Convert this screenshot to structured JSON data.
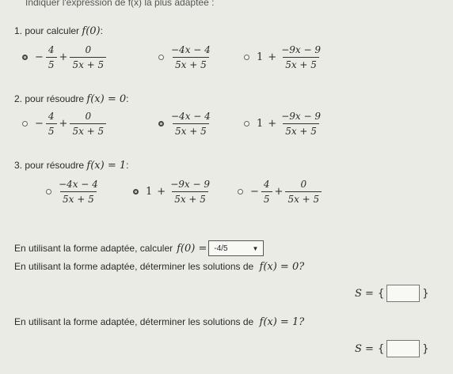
{
  "header": {
    "text": "Indiquer l'expression de f(x) la plus adaptée :"
  },
  "q1": {
    "label": "1. pour calculer",
    "fx": "f(0)",
    "suffix": ":",
    "options": [
      {
        "selected": true,
        "kind": "a"
      },
      {
        "selected": false,
        "kind": "b"
      },
      {
        "selected": false,
        "kind": "c"
      }
    ]
  },
  "q2": {
    "label": "2. pour résoudre",
    "eq": "f(x) = 0",
    "suffix": ":",
    "options": [
      {
        "selected": false,
        "kind": "a"
      },
      {
        "selected": true,
        "kind": "b"
      },
      {
        "selected": false,
        "kind": "c"
      }
    ]
  },
  "q3": {
    "label": "3. pour résoudre",
    "eq": "f(x) = 1",
    "suffix": ":",
    "options": [
      {
        "selected": false,
        "kind": "b"
      },
      {
        "selected": true,
        "kind": "c"
      },
      {
        "selected": false,
        "kind": "a"
      }
    ]
  },
  "expr": {
    "a": {
      "neg": "−",
      "f1_num": "4",
      "f1_den": "5",
      "plus": "+",
      "f2_num": "0",
      "f2_den": "5x + 5"
    },
    "b": {
      "num": "−4x − 4",
      "den": "5x + 5"
    },
    "c": {
      "one": "1",
      "plus": "+",
      "num": "−9x − 9",
      "den": "5x + 5"
    }
  },
  "compute": {
    "text": "En utilisant la forme adaptée, calculer",
    "fx": "f(0) =",
    "dropdown_value": "-4/5",
    "caret": "▼"
  },
  "solve0": {
    "text": "En utilisant la forme adaptée, déterminer les solutions de",
    "eq": "f(x) = 0?",
    "set_label": "S =",
    "open": "{",
    "close": "}"
  },
  "solve1": {
    "text": "En utilisant la forme adaptée, déterminer les solutions de",
    "eq": "f(x) = 1?",
    "set_label": "S =",
    "open": "{",
    "close": "}"
  }
}
